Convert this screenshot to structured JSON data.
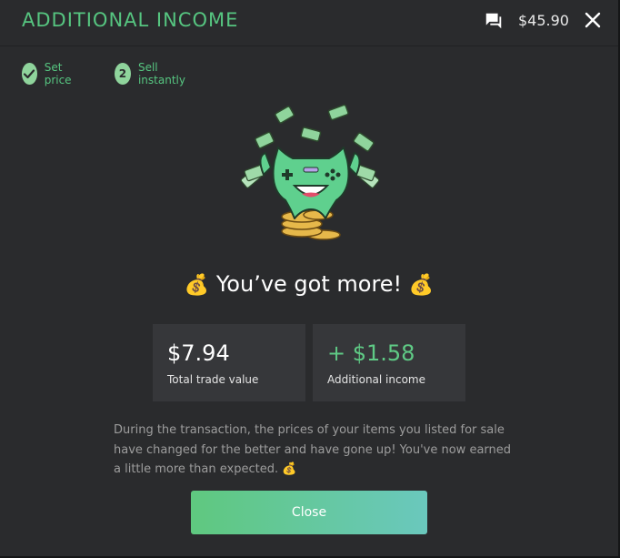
{
  "header": {
    "title": "ADDITIONAL INCOME",
    "balance": "$45.90"
  },
  "steps": [
    {
      "label": "Set price",
      "state": "done"
    },
    {
      "number": "2",
      "label": "Sell instantly",
      "state": "active"
    }
  ],
  "headline": {
    "emoji": "💰",
    "text": "You’ve got more!"
  },
  "cards": [
    {
      "value": "$7.94",
      "label": "Total trade value"
    },
    {
      "value": "+ $1.58",
      "label": "Additional income"
    }
  ],
  "description": "During the transaction, the prices of your items you listed for sale have changed for the better and have gone up! You've now earned a little more than expected. 💰",
  "close_button": "Close",
  "colors": {
    "accent": "#56c580",
    "background": "#2a2b2d",
    "card": "#36373a"
  }
}
